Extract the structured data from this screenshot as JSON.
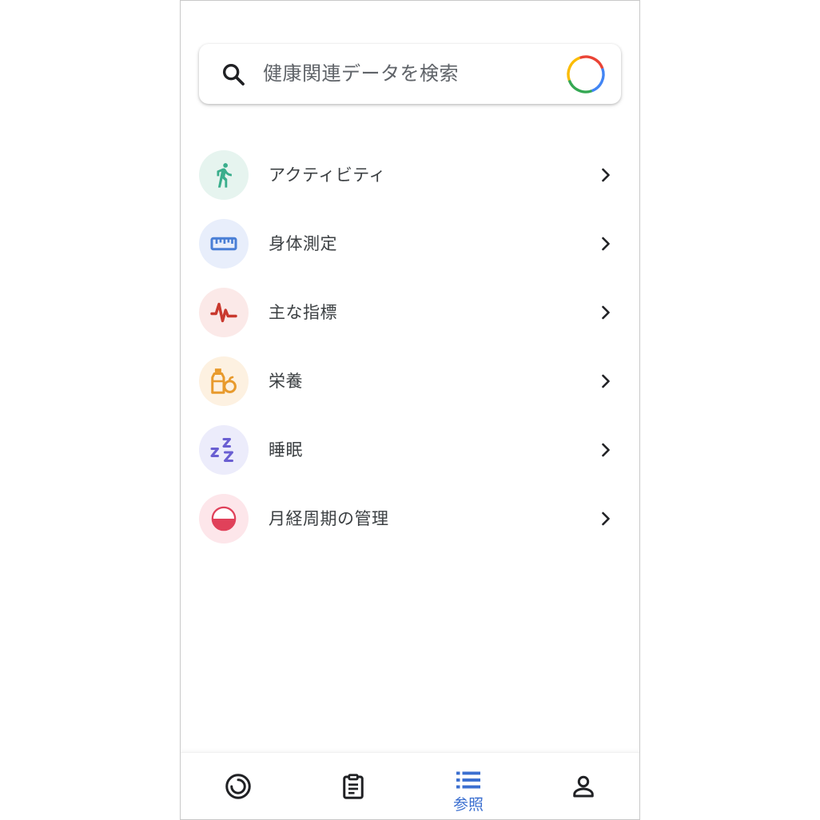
{
  "search": {
    "placeholder": "健康関連データを検索"
  },
  "categories": [
    {
      "label": "アクティビティ",
      "icon": "running-person-icon",
      "bg": "#e6f4ef",
      "color": "#3aae8c"
    },
    {
      "label": "身体測定",
      "icon": "ruler-icon",
      "bg": "#e8eefb",
      "color": "#4a7fd6"
    },
    {
      "label": "主な指標",
      "icon": "vital-signs-icon",
      "bg": "#fbe9e8",
      "color": "#c9392e"
    },
    {
      "label": "栄養",
      "icon": "nutrition-icon",
      "bg": "#fdf1e1",
      "color": "#e89a2c"
    },
    {
      "label": "睡眠",
      "icon": "sleep-zzz-icon",
      "bg": "#ececfb",
      "color": "#6a5fd2"
    },
    {
      "label": "月経周期の管理",
      "icon": "cycle-tracking-icon",
      "bg": "#fde6ea",
      "color": "#e0415a"
    }
  ],
  "bottom_nav": {
    "items": [
      {
        "name": "home",
        "icon": "home-ring-icon",
        "label": "",
        "active": false
      },
      {
        "name": "journal",
        "icon": "clipboard-icon",
        "label": "",
        "active": false
      },
      {
        "name": "browse",
        "icon": "list-icon",
        "label": "参照",
        "active": true
      },
      {
        "name": "profile",
        "icon": "person-icon",
        "label": "",
        "active": false
      }
    ]
  },
  "colors": {
    "accent": "#3b6fd0",
    "text_primary": "#3c4043",
    "text_secondary": "#5f6368",
    "google_blue": "#4285f4",
    "google_red": "#ea4335",
    "google_yellow": "#fbbc05",
    "google_green": "#34a853"
  }
}
